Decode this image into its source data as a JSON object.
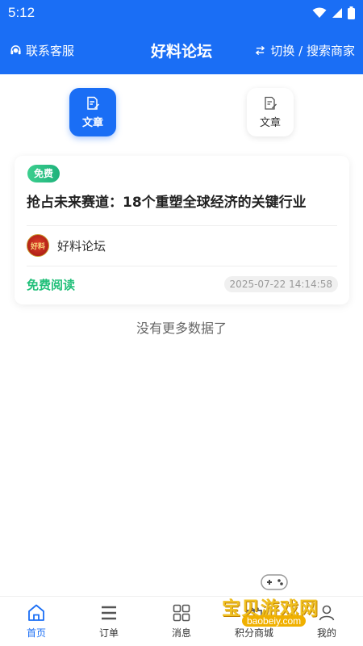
{
  "status_bar": {
    "time": "5:12"
  },
  "header": {
    "service_label": "联系客服",
    "title": "好料论坛",
    "switch_label": "切换 / 搜索商家",
    "bg_color": "#1a6ef5"
  },
  "tabs": [
    {
      "label": "文章",
      "active": true,
      "icon": "article-edit-icon"
    },
    {
      "label": "文章",
      "active": false,
      "icon": "article-edit-icon"
    }
  ],
  "article": {
    "badge": "免费",
    "title": "抢占未来赛道：18个重塑全球经济的关键行业",
    "author": "好料论坛",
    "avatar_text": "好料",
    "read_label": "免费阅读",
    "date": "2025-07-22 14:14:58"
  },
  "list_end_text": "没有更多数据了",
  "bottom_nav": [
    {
      "label": "首页",
      "icon": "home-icon",
      "active": true
    },
    {
      "label": "订单",
      "icon": "menu-list-icon",
      "active": false
    },
    {
      "label": "消息",
      "icon": "grid-icon",
      "active": false
    },
    {
      "label": "积分商城",
      "icon": "gift-icon",
      "active": false
    },
    {
      "label": "我的",
      "icon": "user-icon",
      "active": false
    }
  ],
  "watermark": {
    "text": "宝贝游戏网",
    "url": "baobeiy.com"
  },
  "colors": {
    "primary": "#1a6ef5",
    "green": "#22c07a"
  }
}
